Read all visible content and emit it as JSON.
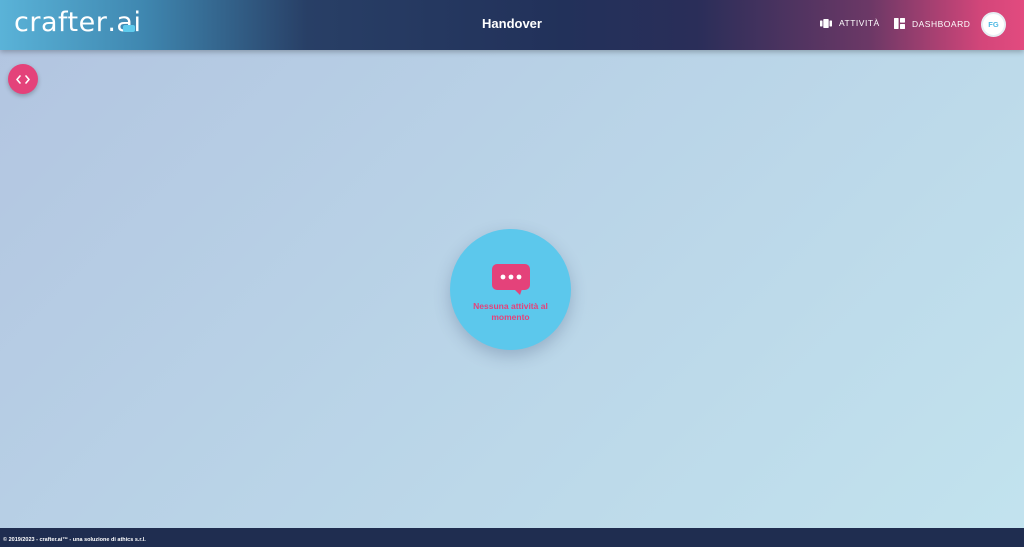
{
  "header": {
    "logo_prefix": "crafter",
    "logo_dot": ".",
    "logo_suffix": "ai",
    "title": "Handover",
    "nav": [
      {
        "label": "ATTIVITÀ",
        "icon": "activity-icon"
      },
      {
        "label": "DASHBOARD",
        "icon": "dashboard-icon"
      }
    ],
    "avatar_initials": "FG"
  },
  "sidebar_toggle": {
    "icon": "code-brackets-icon"
  },
  "empty_state": {
    "icon": "chat-bubble-icon",
    "message": "Nessuna attività al momento"
  },
  "footer": {
    "text": "© 2019/2023 - crafter.ai™ - una soluzione di athics s.r.l."
  },
  "colors": {
    "accent_pink": "#e4427a",
    "accent_blue": "#5cc8ec",
    "footer_bg": "#1f2d50"
  }
}
